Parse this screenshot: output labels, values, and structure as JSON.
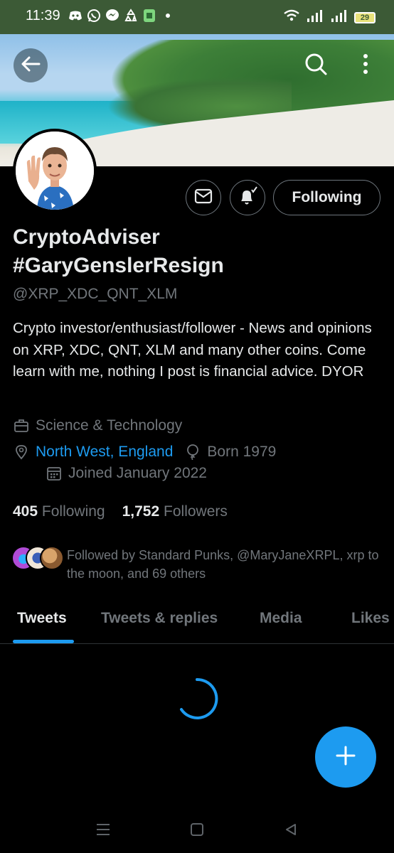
{
  "status_bar": {
    "time": "11:39",
    "battery": "29",
    "icons": [
      "discord-icon",
      "whatsapp-icon",
      "messenger-icon",
      "recycle-icon",
      "app-icon",
      "dot-icon",
      "wifi-icon",
      "signal-icon",
      "signal-icon",
      "battery-icon"
    ]
  },
  "header": {
    "back_icon": "arrow-left-icon",
    "search_icon": "search-icon",
    "more_icon": "more-vertical-icon"
  },
  "profile": {
    "name_line1": "CryptoAdviser",
    "name_line2": "#GaryGenslerResign",
    "handle": "@XRP_XDC_QNT_XLM",
    "bio": "Crypto investor/enthusiast/follower - News and opinions on XRP, XDC, QNT, XLM and many other coins. Come learn with me, nothing I post is financial advice. DYOR",
    "category": "Science & Technology",
    "location": "North West, England",
    "born": "Born 1979",
    "joined": "Joined January 2022",
    "following_count": "405",
    "following_label": "Following",
    "followers_count": "1,752",
    "followers_label": "Followers",
    "followed_by": "Followed by Standard Punks, @MaryJaneXRPL, xrp to the moon, and 69 others"
  },
  "actions": {
    "message_icon": "mail-icon",
    "notify_icon": "bell-check-icon",
    "following_button": "Following"
  },
  "tabs": [
    {
      "label": "Tweets",
      "active": true
    },
    {
      "label": "Tweets & replies",
      "active": false
    },
    {
      "label": "Media",
      "active": false
    },
    {
      "label": "Likes",
      "active": false
    }
  ],
  "fab": {
    "icon": "plus-icon"
  },
  "nav": [
    "menu-icon",
    "home-square-icon",
    "back-triangle-icon"
  ],
  "colors": {
    "accent": "#1d9bf0",
    "status_bar": "#3c5a36",
    "secondary_text": "#71767b",
    "primary_text": "#e7e9ea"
  }
}
